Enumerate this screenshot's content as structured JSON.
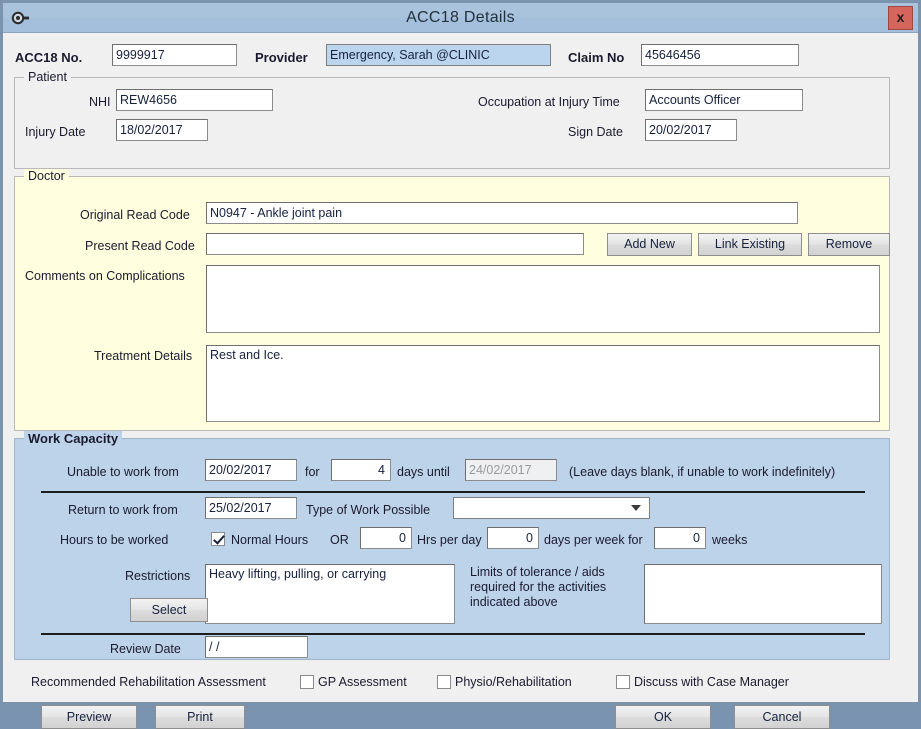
{
  "window": {
    "title": "ACC18  Details",
    "system_icon": "gear-icon",
    "close_label": "x"
  },
  "header": {
    "acc18_no_label": "ACC18 No.",
    "acc18_no_value": "9999917",
    "provider_label": "Provider",
    "provider_value": "Emergency, Sarah @CLINIC",
    "claim_no_label": "Claim No",
    "claim_no_value": "45646456"
  },
  "patient": {
    "caption": "Patient",
    "nhi_label": "NHI",
    "nhi_value": "REW4656",
    "occupation_label": "Occupation at Injury Time",
    "occupation_value": "Accounts Officer",
    "injury_date_label": "Injury Date",
    "injury_date_value": "18/02/2017",
    "sign_date_label": "Sign Date",
    "sign_date_value": "20/02/2017"
  },
  "doctor": {
    "caption": "Doctor",
    "original_read_code_label": "Original Read Code",
    "original_read_code_value": "N0947 - Ankle joint pain",
    "present_read_code_label": "Present Read Code",
    "present_read_code_value": "",
    "add_new_label": "Add New",
    "link_existing_label": "Link Existing",
    "remove_label": "Remove",
    "comments_label": "Comments on Complications",
    "comments_value": "",
    "treatment_label": "Treatment Details",
    "treatment_value": "Rest and Ice."
  },
  "work_capacity": {
    "caption": "Work Capacity",
    "unable_label": "Unable to work  from",
    "unable_from_value": "20/02/2017",
    "for_label": "for",
    "for_days_value": "4",
    "days_until_label": "days  until",
    "until_value": "24/02/2017",
    "hint": "(Leave days blank, if unable to work indefinitely)",
    "return_label": "Return to work  from",
    "return_from_value": "25/02/2017",
    "type_of_work_label": "Type of Work Possible",
    "type_of_work_value": "",
    "hours_label": "Hours to be worked",
    "normal_hours_label": "Normal Hours",
    "normal_hours_checked": true,
    "or_label": "OR",
    "hrs_per_day_value": "0",
    "hrs_per_day_label": "Hrs per day",
    "days_per_week_value": "0",
    "days_per_week_label": "days per week for",
    "weeks_value": "0",
    "weeks_label": "weeks",
    "restrictions_label": "Restrictions",
    "restrictions_value": "Heavy lifting, pulling, or carrying",
    "select_label": "Select",
    "limits_label": "Limits of tolerance / aids required for the activities indicated above",
    "limits_value": "",
    "review_date_label": "Review Date",
    "review_date_value": "/ /"
  },
  "footer": {
    "recommended_label": "Recommended Rehabilitation Assessment",
    "gp_assessment_label": "GP Assessment",
    "gp_assessment_checked": false,
    "physio_label": "Physio/Rehabilitation",
    "physio_checked": false,
    "case_manager_label": "Discuss with Case Manager",
    "case_manager_checked": false,
    "preview_label": "Preview",
    "print_label": "Print",
    "ok_label": "OK",
    "cancel_label": "Cancel"
  },
  "colors": {
    "titlebar": "#a9c3dd",
    "close": "#d4645c",
    "doctor_panel": "#ffffe0",
    "work_panel": "#bdd3ea",
    "highlight_field": "#bcd5ee"
  }
}
